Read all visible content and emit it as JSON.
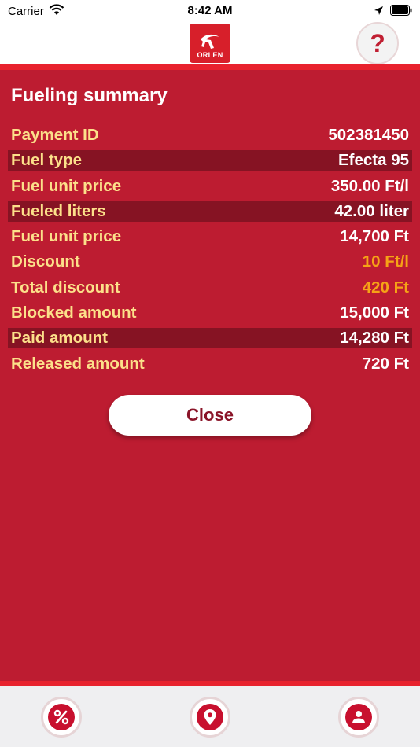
{
  "status_bar": {
    "carrier": "Carrier",
    "time": "8:42 AM"
  },
  "header": {
    "logo_text": "ORLEN",
    "help_label": "?"
  },
  "summary": {
    "title": "Fueling summary",
    "rows": [
      {
        "label": "Payment ID",
        "value": "502381450"
      },
      {
        "label": "Fuel type",
        "value": "Efecta 95"
      },
      {
        "label": "Fuel unit price",
        "value": "350.00 Ft/l"
      },
      {
        "label": "Fueled liters",
        "value": "42.00 liter"
      },
      {
        "label": "Fuel unit price",
        "value": "14,700 Ft"
      },
      {
        "label": "Discount",
        "value": "10 Ft/l"
      },
      {
        "label": "Total discount",
        "value": "420 Ft"
      },
      {
        "label": "Blocked amount",
        "value": "15,000 Ft"
      },
      {
        "label": "Paid amount",
        "value": "14,280 Ft"
      },
      {
        "label": "Released amount",
        "value": "720 Ft"
      }
    ],
    "close_label": "Close"
  },
  "tab_bar": {
    "items": [
      "percent-icon",
      "location-pin-icon",
      "profile-icon"
    ]
  },
  "colors": {
    "background_red": "#bd1c31",
    "highlight_row": "#861323",
    "label_yellow": "#fce08a",
    "accent_orange": "#f6a316"
  }
}
